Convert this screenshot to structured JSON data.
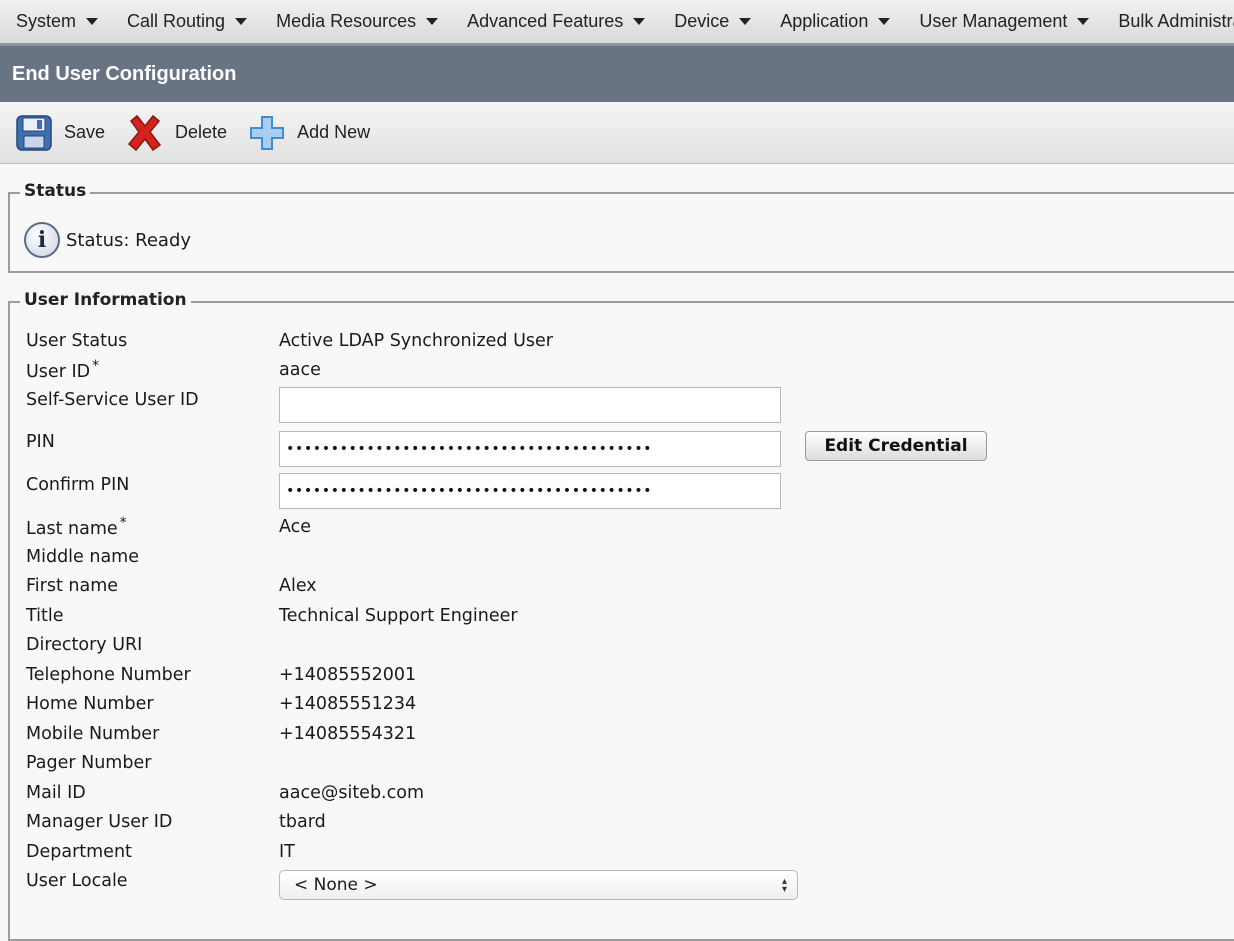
{
  "menubar": {
    "items": [
      "System",
      "Call Routing",
      "Media Resources",
      "Advanced Features",
      "Device",
      "Application",
      "User Management",
      "Bulk Administration"
    ]
  },
  "page": {
    "title": "End User Configuration"
  },
  "toolbar": {
    "save_label": "Save",
    "delete_label": "Delete",
    "add_new_label": "Add New"
  },
  "status": {
    "legend": "Status",
    "text": "Status: Ready"
  },
  "user_info": {
    "legend": "User Information",
    "user_status_label": "User Status",
    "user_status_value": "Active LDAP Synchronized User",
    "user_id_label": "User ID",
    "user_id_required": "*",
    "user_id_value": "aace",
    "self_service_label": "Self-Service User ID",
    "self_service_value": "",
    "pin_label": "PIN",
    "pin_value": "•••••••••••••••••••••••••••••••••••••••••",
    "edit_credential_label": "Edit Credential",
    "confirm_pin_label": "Confirm PIN",
    "confirm_pin_value": "•••••••••••••••••••••••••••••••••••••••••",
    "last_name_label": "Last name",
    "last_name_required": "*",
    "last_name_value": "Ace",
    "middle_name_label": "Middle name",
    "middle_name_value": "",
    "first_name_label": "First name",
    "first_name_value": "Alex",
    "title_label": "Title",
    "title_value": "Technical Support Engineer",
    "directory_uri_label": "Directory URI",
    "directory_uri_value": "",
    "telephone_label": "Telephone Number",
    "telephone_value": "+14085552001",
    "home_label": "Home Number",
    "home_value": "+14085551234",
    "mobile_label": "Mobile Number",
    "mobile_value": "+14085554321",
    "pager_label": "Pager Number",
    "pager_value": "",
    "mail_label": "Mail ID",
    "mail_value": "aace@siteb.com",
    "manager_label": "Manager User ID",
    "manager_value": "tbard",
    "department_label": "Department",
    "department_value": "IT",
    "locale_label": "User Locale",
    "locale_value": "< None >"
  },
  "colors": {
    "title_bar": "#687484",
    "delete_red": "#d2231c",
    "add_blue": "#3a8fd6"
  },
  "icons": {
    "save": "floppy-disk-icon",
    "delete": "red-x-icon",
    "add": "plus-icon",
    "status": "info-icon"
  }
}
